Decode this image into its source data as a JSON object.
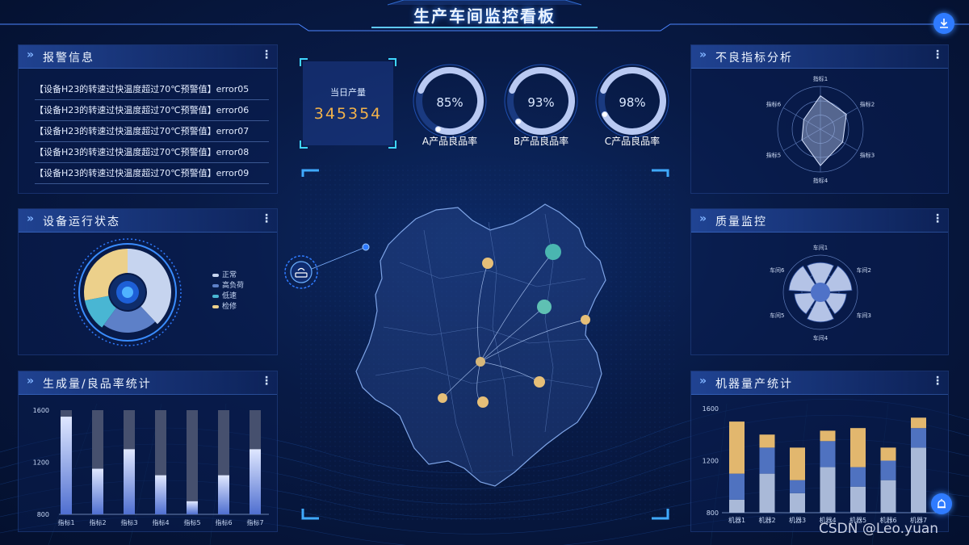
{
  "header": {
    "title": "生产车间监控看板"
  },
  "panels": {
    "alarm": {
      "title": "报警信息"
    },
    "device": {
      "title": "设备运行状态"
    },
    "production": {
      "title": "生成量/良品率统计"
    },
    "defect": {
      "title": "不良指标分析"
    },
    "quality": {
      "title": "质量监控"
    },
    "machine": {
      "title": "机器量产统计"
    }
  },
  "alarms": [
    "【设备H23的转速过快温度超过70℃预警值】error05",
    "【设备H23的转速过快温度超过70℃预警值】error06",
    "【设备H23的转速过快温度超过70℃预警值】error07",
    "【设备H23的转速过快温度超过70℃预警值】error08",
    "【设备H23的转速过快温度超过70℃预警值】error09"
  ],
  "daily_output": {
    "label": "当日产量",
    "value": "345354"
  },
  "gauges": [
    {
      "pct": "85%",
      "label": "A产品良品率",
      "value": 0.85
    },
    {
      "pct": "93%",
      "label": "B产品良品率",
      "value": 0.93
    },
    {
      "pct": "98%",
      "label": "C产品良品率",
      "value": 0.98
    }
  ],
  "device_status": {
    "legend": [
      "正常",
      "高负荷",
      "低速",
      "检修"
    ],
    "colors": [
      "#c6d4ef",
      "#5d80c8",
      "#49b6d3",
      "#ecd08b"
    ],
    "values": [
      0.38,
      0.22,
      0.12,
      0.28
    ]
  },
  "colors": {
    "accent": "#2f7bff",
    "gold": "#f2b24a",
    "cyan": "#3fd6ff"
  },
  "icons": {
    "download": "download-icon",
    "alarm": "alarm-bell-icon",
    "router": "router-icon"
  },
  "chart_data": [
    {
      "type": "bar",
      "categories": [
        "指标1",
        "指标2",
        "指标3",
        "指标4",
        "指标5",
        "指标6",
        "指标7"
      ],
      "series": [
        {
          "values": [
            1550,
            1150,
            1300,
            1100,
            900,
            1100,
            1300
          ]
        }
      ],
      "background_max": [
        1600,
        1600,
        1600,
        1600,
        1600,
        1600,
        1600
      ],
      "yticks": [
        1600,
        1200,
        800
      ],
      "ylim": [
        800,
        1600
      ]
    },
    {
      "type": "radar",
      "indicators": [
        "指标1",
        "指标2",
        "指标3",
        "指标4",
        "指标5",
        "指标6"
      ],
      "values": [
        0.78,
        0.7,
        0.6,
        0.85,
        0.5,
        0.45
      ]
    },
    {
      "type": "polar-bar",
      "categories": [
        "车间1",
        "车间2",
        "车间3",
        "车间4",
        "车间5",
        "车间6"
      ],
      "values": [
        0.8,
        0.85,
        0.7,
        0.8,
        0.7,
        0.85
      ]
    },
    {
      "type": "bar",
      "stacked": true,
      "categories": [
        "机器1",
        "机器2",
        "机器3",
        "机器4",
        "机器5",
        "机器6",
        "机器7"
      ],
      "series": [
        {
          "values": [
            900,
            1100,
            950,
            1150,
            1000,
            1050,
            1300
          ]
        },
        {
          "values": [
            200,
            200,
            100,
            200,
            150,
            150,
            150
          ]
        },
        {
          "values": [
            400,
            100,
            250,
            80,
            300,
            100,
            80
          ]
        }
      ],
      "series_colors": [
        "#a9b9d8",
        "#4f72c0",
        "#e2b76e"
      ],
      "yticks": [
        1600,
        1200,
        800
      ],
      "ylim": [
        800,
        1600
      ]
    }
  ],
  "watermark": "CSDN @Leo.yuan"
}
